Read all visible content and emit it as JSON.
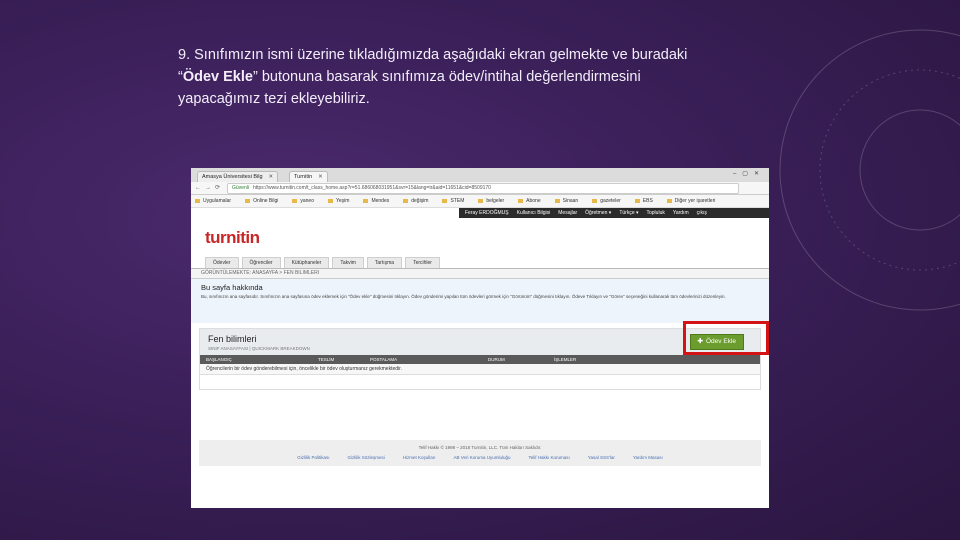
{
  "caption": {
    "line1": "9. Sınıfımızın ismi üzerine tıkladığımızda aşağıdaki ekran gelmekte ve buradaki",
    "line2_pre": "“",
    "line2_bold": "Ödev Ekle",
    "line2_post": "” butonuna basarak sınıfımıza ödev/intihal değerlendirmesini",
    "line3": "yapacağımız tezi ekleyebiliriz."
  },
  "browser": {
    "tab1": "Amasya Üniversitesi Bilg",
    "tab2": "Turnitin",
    "url_secure": "Güvenli",
    "url": "https://www.turnitin.com/t_class_home.asp?r=51.686068031951&svr=15&lang=tr&aid=11651&cid=8509170",
    "bookmarks": [
      "Uygulamalar",
      "Online Bilgi",
      "yaneo",
      "Yeşim",
      "Mendes",
      "değişim",
      "STEM",
      "belgeler",
      "Abone",
      "Sinaan",
      "gazeteler",
      "EBS",
      "Diğer yer işaretleri"
    ]
  },
  "userbar": {
    "items": [
      "Feray ERDOĞMUŞ",
      "Kullanıcı Bilgisi",
      "Mesajlar",
      "Öğretmen ▾",
      "Türkçe ▾",
      "Topluluk",
      "Yardım",
      "çıkış"
    ]
  },
  "logo": {
    "text": "turnitin"
  },
  "navtabs": [
    "Ödevler",
    "Öğrenciler",
    "Kütüphaneler",
    "Takvim",
    "Tartışma",
    "Tercihler"
  ],
  "breadcrumb": "GÖRÜNTÜLEMEKTE: ANASAYFA > FEN BILIMLERI",
  "about": {
    "title": "Bu sayfa hakkında",
    "text": "Bu, sınıfınızın ana sayfasıdır. Sınıfınızın ana sayfasına ödev eklemek için \"Ödev ekle\" düğmesini tıklayın. Ödev gönderimi yapılan tüm ödevleri görmek için \"Görünüm\" düğmesini tıklayın. Ödeve Tıklayın ve \"Görev\" seçeneğini kullanarak tüm ödevlerinizi düzenleyin."
  },
  "panel": {
    "title": "Fen bilimleri",
    "sub": "SINIF ANASAYFASI | QUICKMARK BREAKDOWN",
    "add_button": "Ödev Ekle",
    "columns": [
      "BAŞLANGIÇ",
      "TESLİM",
      "POSTALAMA",
      "DURUM",
      "İŞLEMLER"
    ],
    "empty_row": "Öğrencilerin bir ödev gönderebilmesi için, öncelikle bir ödev oluşturmanız gerekmektedir."
  },
  "footer": {
    "copy": "Telif Hakkı © 1998 – 2018 Turnitin, LLC. Tüm Hakları Saklıdır.",
    "links": [
      "Gizlilik Politikası",
      "Gizlilik Sözleşmesi",
      "Hizmet Koşulları",
      "AB Veri Koruma Uyumluluğu",
      "Telif Hakkı Koruması",
      "Yasal SSS'lar",
      "Yardım Masası"
    ]
  }
}
